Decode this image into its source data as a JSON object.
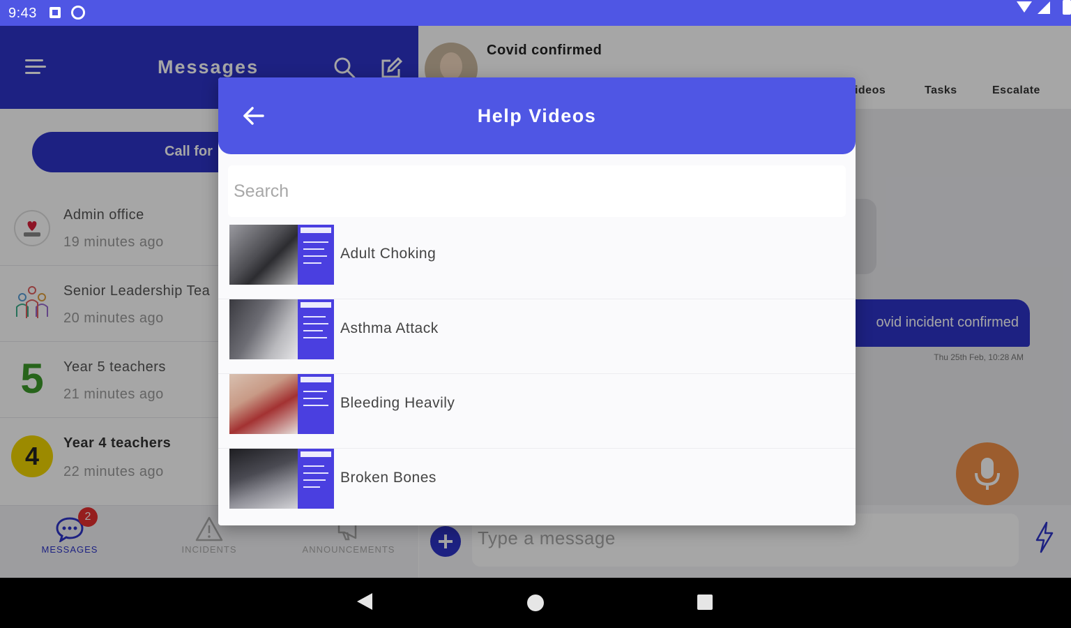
{
  "status_bar": {
    "time": "9:43"
  },
  "messages_panel": {
    "title": "Messages",
    "call_button_label": "Call for",
    "conversations": [
      {
        "name": "Admin office",
        "time": "19 minutes ago",
        "avatar": "admin-heart-icon",
        "bold": false
      },
      {
        "name": "Senior Leadership Tea",
        "time": "20 minutes ago",
        "avatar": "team-people-icon",
        "bold": false
      },
      {
        "name": "Year 5 teachers",
        "time": "21 minutes ago",
        "avatar": "number-5-icon",
        "avatar_text": "5",
        "bold": false
      },
      {
        "name": "Year 4 teachers",
        "time": "22 minutes ago",
        "avatar": "number-4-icon",
        "avatar_text": "4",
        "bold": true
      }
    ]
  },
  "bottom_nav": {
    "items": [
      {
        "label": "MESSAGES",
        "icon": "chat-bubble-icon",
        "badge": "2",
        "active": true
      },
      {
        "label": "INCIDENTS",
        "icon": "warning-triangle-icon",
        "active": false
      },
      {
        "label": "ANNOUNCEMENTS",
        "icon": "megaphone-icon",
        "active": false
      }
    ]
  },
  "chat_panel": {
    "title": "Covid confirmed",
    "tabs": [
      "Videos",
      "Tasks",
      "Escalate"
    ],
    "tab_first_visible": "/ideos",
    "bubble_text": "ovid incident confirmed",
    "bubble_time": "Thu 25th Feb, 10:28 AM",
    "input_placeholder": "Type a message"
  },
  "help_videos": {
    "title": "Help Videos",
    "search_placeholder": "Search",
    "videos": [
      {
        "label": "Adult Choking"
      },
      {
        "label": "Asthma Attack"
      },
      {
        "label": "Bleeding Heavily"
      },
      {
        "label": "Broken Bones"
      }
    ]
  },
  "colors": {
    "primary": "#4f56e4",
    "header_dark": "#2d34c8",
    "mic_orange": "#f09048",
    "badge_red": "#e52e2e"
  }
}
